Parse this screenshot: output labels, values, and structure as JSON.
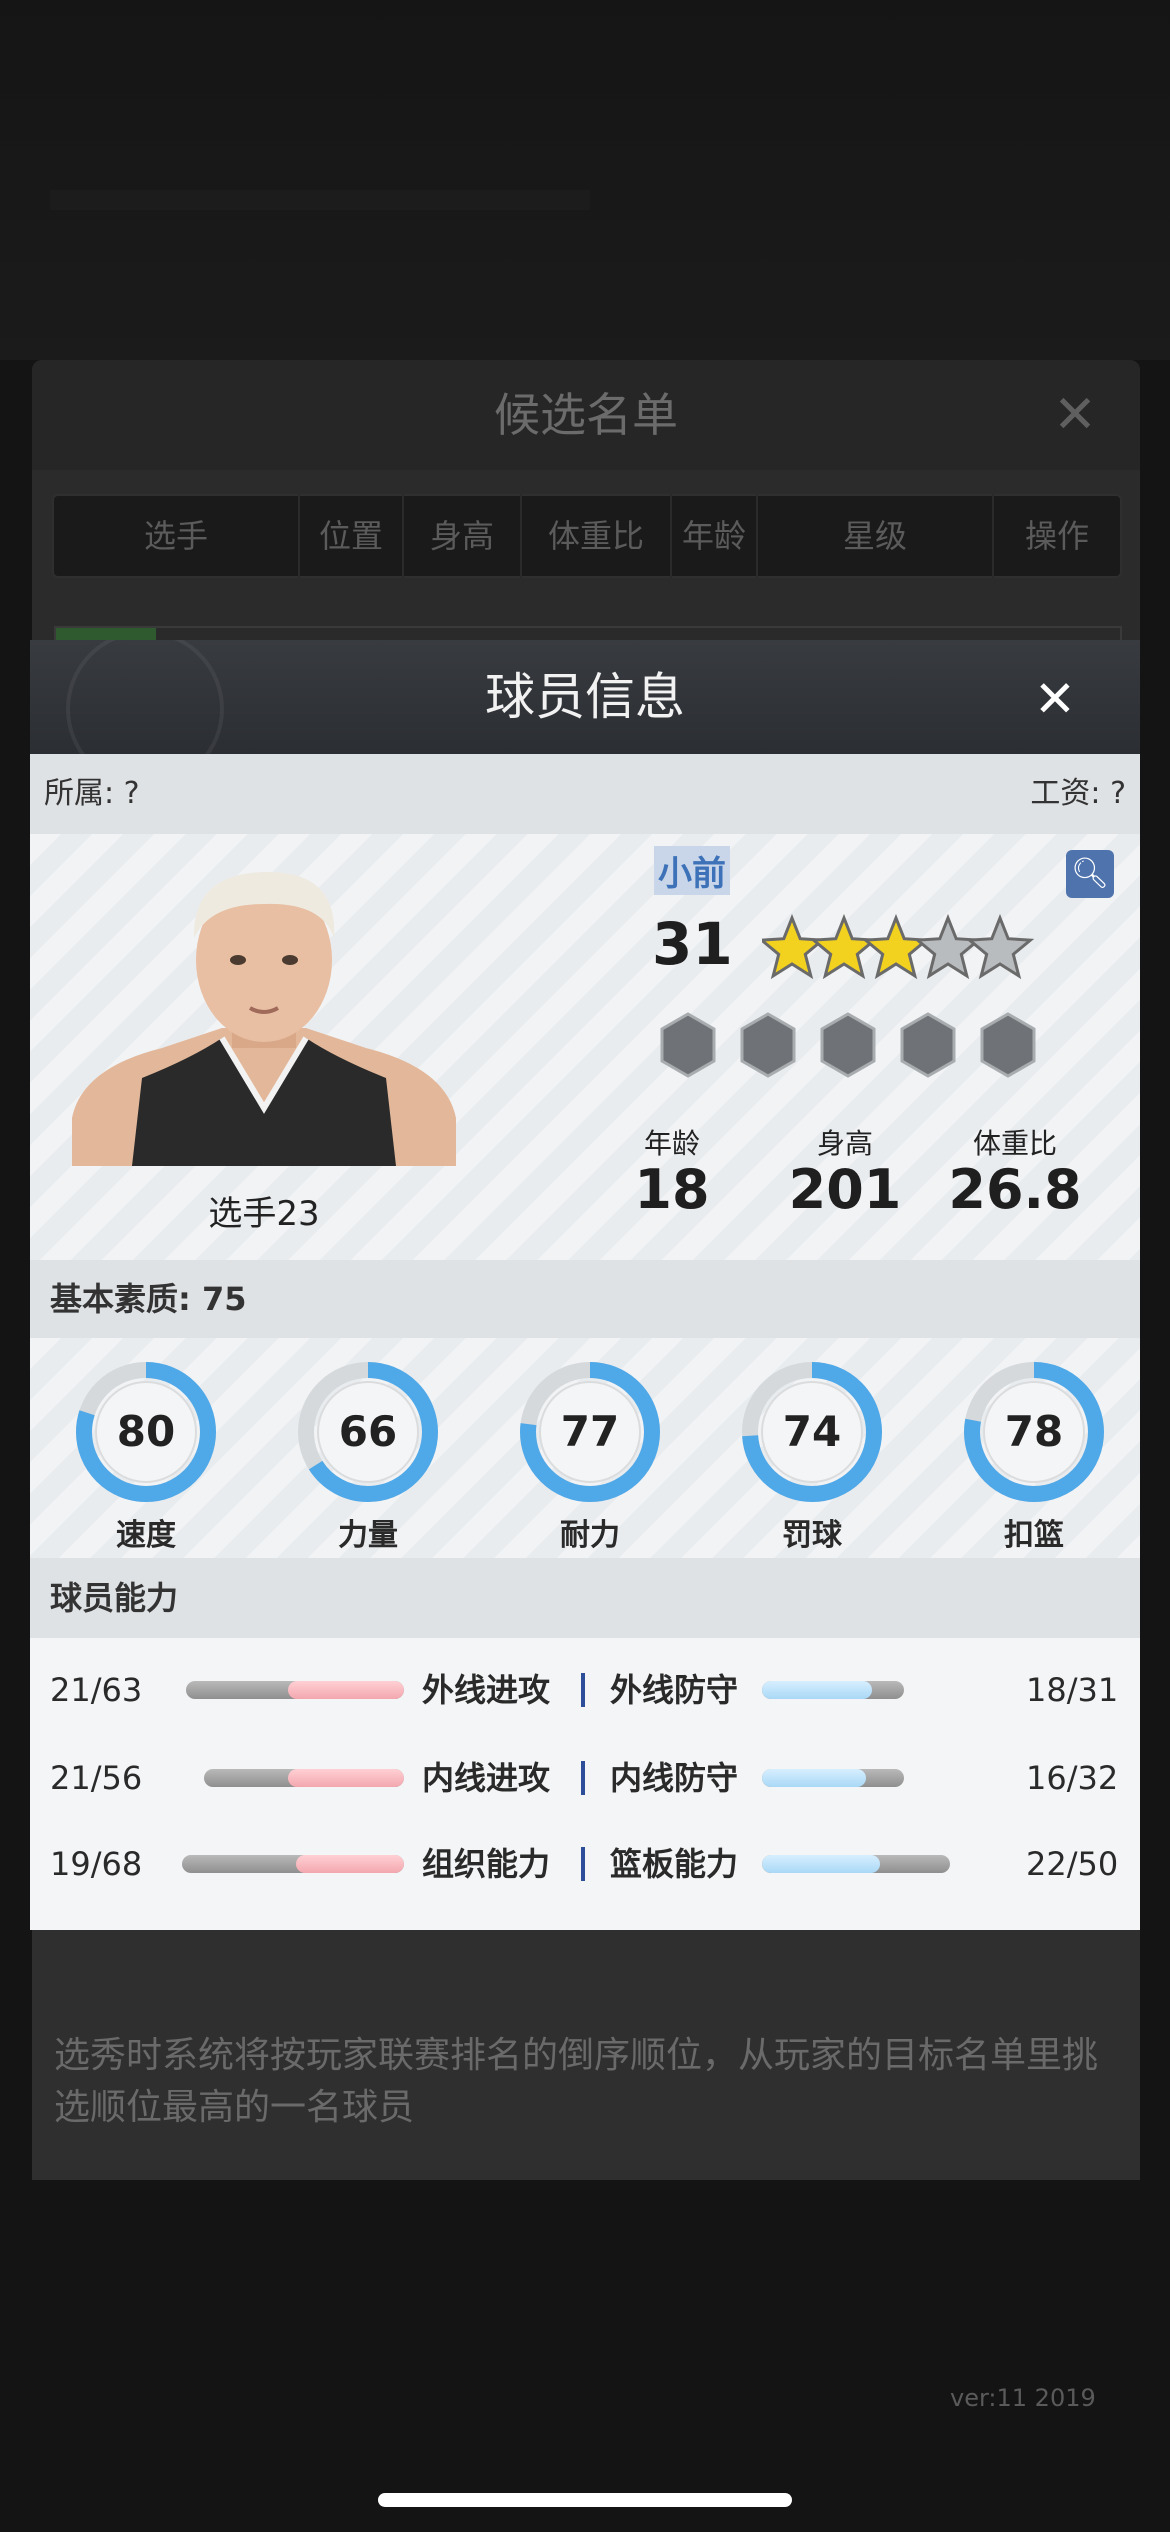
{
  "background": {
    "dialog_title": "候选名单",
    "close_glyph": "✕",
    "tabs": [
      "选手",
      "位置",
      "身高",
      "体重比",
      "年龄",
      "星级",
      "操作"
    ],
    "note": "选秀时系统将按玩家联赛排名的倒序顺位，从玩家的目标名单里挑选顺位最高的一名球员",
    "version": "ver:11  2019"
  },
  "modal": {
    "title": "球员信息",
    "close_glyph": "✕",
    "owner": "所属: ?",
    "salary": "工资: ?",
    "player": {
      "name": "选手23",
      "position": "小前",
      "rating": "31",
      "stars": {
        "filled": 3,
        "total": 5
      },
      "age_label": "年龄",
      "age": "18",
      "height_label": "身高",
      "height": "201",
      "weight_label": "体重比",
      "weight": "26.8"
    },
    "basic_quality": "基本素质: 75",
    "rings": [
      {
        "label": "速度",
        "value": 80
      },
      {
        "label": "力量",
        "value": 66
      },
      {
        "label": "耐力",
        "value": 77
      },
      {
        "label": "罚球",
        "value": 74
      },
      {
        "label": "扣篮",
        "value": 78
      }
    ],
    "ability_title": "球员能力",
    "abilities": [
      {
        "left_value": "21/63",
        "left_label": "外线进攻",
        "right_label": "外线防守",
        "right_value": "18/31"
      },
      {
        "left_value": "21/56",
        "left_label": "内线进攻",
        "right_label": "内线防守",
        "right_value": "16/32"
      },
      {
        "left_value": "19/68",
        "left_label": "组织能力",
        "right_label": "篮板能力",
        "right_value": "22/50"
      }
    ],
    "colors": {
      "ring_blue": "#4fa8e8",
      "ring_track": "#d6d9dc",
      "star_gold": "#f3d21f",
      "star_gray": "#b9bcbf",
      "pos_blue": "#3d72b8"
    }
  }
}
